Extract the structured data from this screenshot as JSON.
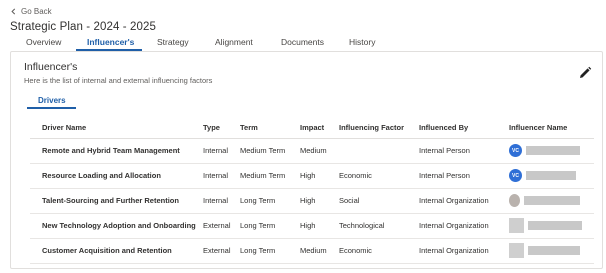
{
  "nav": {
    "back_label": "Go Back",
    "page_title": "Strategic Plan - 2024 - 2025"
  },
  "tabs": [
    {
      "label": "Overview",
      "active": false
    },
    {
      "label": "Influencer's",
      "active": true
    },
    {
      "label": "Strategy",
      "active": false
    },
    {
      "label": "Alignment",
      "active": false
    },
    {
      "label": "Documents",
      "active": false
    },
    {
      "label": "History",
      "active": false
    }
  ],
  "section": {
    "heading": "Influencer's",
    "subtitle": "Here is the list of internal and external influencing factors",
    "edit_icon": "pencil-icon",
    "subtab_label": "Drivers"
  },
  "table": {
    "columns": [
      "Driver Name",
      "Type",
      "Term",
      "Impact",
      "Influencing Factor",
      "Influenced By",
      "Influencer Name"
    ],
    "rows": [
      {
        "driver": "Remote and Hybrid Team Management",
        "type": "Internal",
        "term": "Medium Term",
        "impact": "Medium",
        "factor": "",
        "influenced_by": "Internal Person",
        "avatar_initials": "VC",
        "avatar_kind": "initials"
      },
      {
        "driver": "Resource Loading and Allocation",
        "type": "Internal",
        "term": "Medium Term",
        "impact": "High",
        "factor": "Economic",
        "influenced_by": "Internal Person",
        "avatar_initials": "VC",
        "avatar_kind": "initials"
      },
      {
        "driver": "Talent-Sourcing and Further Retention",
        "type": "Internal",
        "term": "Long Term",
        "impact": "High",
        "factor": "Social",
        "influenced_by": "Internal Organization",
        "avatar_initials": "",
        "avatar_kind": "photo"
      },
      {
        "driver": "New Technology Adoption and Onboarding",
        "type": "External",
        "term": "Long Term",
        "impact": "High",
        "factor": "Technological",
        "influenced_by": "Internal Organization",
        "avatar_initials": "",
        "avatar_kind": "square"
      },
      {
        "driver": "Customer Acquisition and Retention",
        "type": "External",
        "term": "Long Term",
        "impact": "Medium",
        "factor": "Economic",
        "influenced_by": "Internal Organization",
        "avatar_initials": "",
        "avatar_kind": "square"
      }
    ]
  },
  "colors": {
    "accent": "#1f5fa8",
    "avatar_blue": "#2f6fd6",
    "redaction_gray": "#c8c8c8"
  }
}
